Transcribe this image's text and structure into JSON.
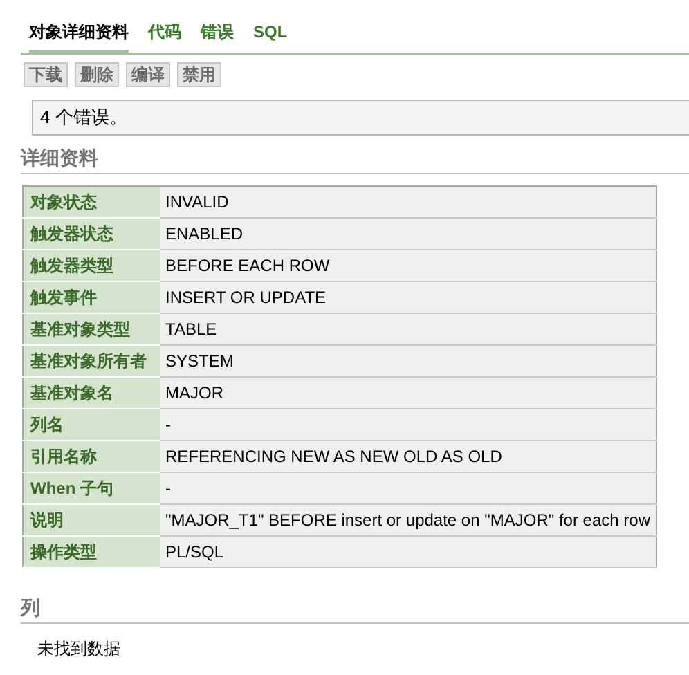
{
  "tabs": [
    {
      "label": "对象详细资料",
      "selected": true
    },
    {
      "label": "代码",
      "selected": false
    },
    {
      "label": "错误",
      "selected": false
    },
    {
      "label": "SQL",
      "selected": false
    }
  ],
  "actions": [
    "下载",
    "删除",
    "编译",
    "禁用"
  ],
  "message": "4 个错误。",
  "details": {
    "heading": "详细资料",
    "rows": [
      {
        "label": "对象状态",
        "value": "INVALID"
      },
      {
        "label": "触发器状态",
        "value": "ENABLED"
      },
      {
        "label": "触发器类型",
        "value": "BEFORE EACH ROW"
      },
      {
        "label": "触发事件",
        "value": "INSERT OR UPDATE"
      },
      {
        "label": "基准对象类型",
        "value": "TABLE"
      },
      {
        "label": "基准对象所有者",
        "value": "SYSTEM"
      },
      {
        "label": "基准对象名",
        "value": "MAJOR"
      },
      {
        "label": "列名",
        "value": "-"
      },
      {
        "label": "引用名称",
        "value": "REFERENCING NEW AS NEW OLD AS OLD"
      },
      {
        "label": "When 子句",
        "value": "-"
      },
      {
        "label": "说明",
        "value": "\"MAJOR_T1\" BEFORE insert or update on \"MAJOR\" for each row"
      },
      {
        "label": "操作类型",
        "value": "PL/SQL"
      }
    ]
  },
  "columns": {
    "heading": "列",
    "empty_text": "未找到数据"
  }
}
